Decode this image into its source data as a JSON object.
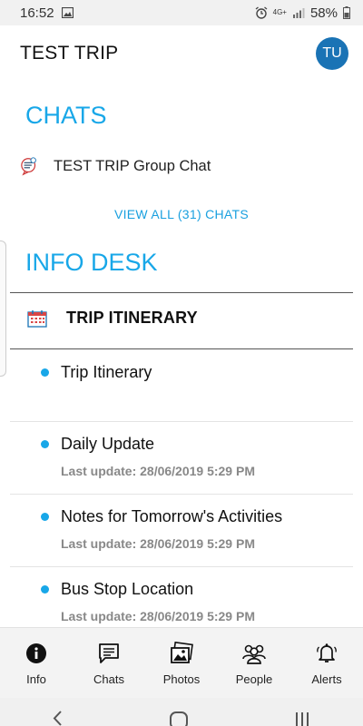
{
  "status_bar": {
    "time": "16:52",
    "network": "4G+",
    "battery": "58%"
  },
  "app_bar": {
    "title": "TEST TRIP",
    "avatar_initials": "TU"
  },
  "chats": {
    "heading": "CHATS",
    "group_chat_label": "TEST TRIP Group Chat",
    "view_all_label": "VIEW ALL (31) CHATS"
  },
  "info_desk": {
    "heading": "INFO DESK",
    "section_title": "TRIP ITINERARY",
    "items": [
      {
        "title": "Trip Itinerary",
        "subtitle": ""
      },
      {
        "title": "Daily Update",
        "subtitle": "Last update: 28/06/2019 5:29 PM"
      },
      {
        "title": "Notes for Tomorrow's Activities",
        "subtitle": "Last update: 28/06/2019 5:29 PM"
      },
      {
        "title": "Bus Stop Location",
        "subtitle": "Last update: 28/06/2019 5:29 PM"
      }
    ]
  },
  "bottom_nav": {
    "items": [
      {
        "label": "Info",
        "icon": "info-icon"
      },
      {
        "label": "Chats",
        "icon": "chat-icon"
      },
      {
        "label": "Photos",
        "icon": "photos-icon"
      },
      {
        "label": "People",
        "icon": "people-icon"
      },
      {
        "label": "Alerts",
        "icon": "bell-icon"
      }
    ]
  },
  "colors": {
    "accent": "#18a7e8",
    "avatar_bg": "#1a73b5"
  }
}
